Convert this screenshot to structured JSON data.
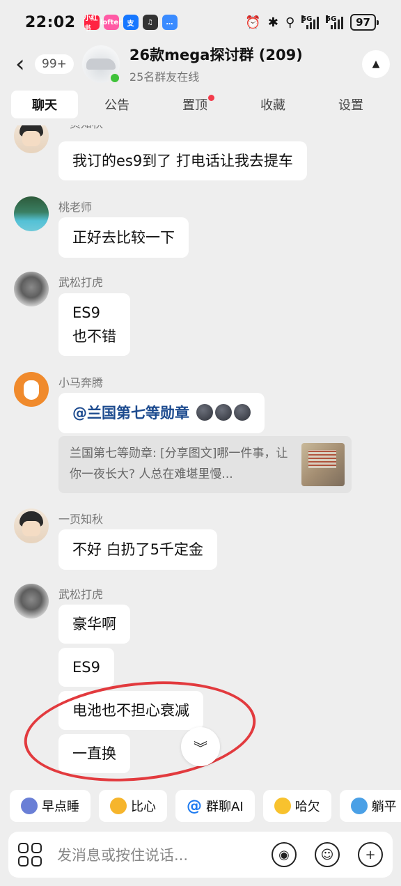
{
  "status_bar": {
    "time": "22:02",
    "apps": [
      {
        "icon": "xiaohongshu-app-icon",
        "color": "#ff2442",
        "label": "小红书"
      },
      {
        "icon": "lofter-app-icon",
        "color": "#ff5aa5",
        "label": "lofter"
      },
      {
        "icon": "alipay-app-icon",
        "color": "#1677ff",
        "label": "支"
      },
      {
        "icon": "audio-app-icon",
        "color": "#333333",
        "label": "♫"
      },
      {
        "icon": "message-app-icon",
        "color": "#3a8bff",
        "label": "…"
      }
    ],
    "signal_label_1": "5G",
    "signal_label_2": "5G",
    "battery": "97"
  },
  "header": {
    "back_badge": "99+",
    "title": "26款mega探讨群 (209)",
    "subtitle": "25名群友在线"
  },
  "tabs": [
    {
      "label": "聊天",
      "active": true
    },
    {
      "label": "公告"
    },
    {
      "label": "置顶",
      "dot": true
    },
    {
      "label": "收藏"
    },
    {
      "label": "设置"
    }
  ],
  "messages": [
    {
      "sender": "一页知秋",
      "text": "我订的es9到了 打电话让我去提车"
    },
    {
      "sender": "桃老师",
      "text": "正好去比较一下"
    },
    {
      "sender": "武松打虎",
      "lines": [
        "ES9",
        "也不错"
      ]
    },
    {
      "sender": "小马奔腾",
      "mention": "@兰国第七等勋章",
      "quote": "兰国第七等勋章: [分享图文]哪一件事，让你一夜长大? 人总在难堪里慢..."
    },
    {
      "sender": "一页知秋",
      "text": "不好 白扔了5千定金"
    },
    {
      "sender": "武松打虎",
      "texts": [
        "豪华啊",
        "ES9",
        "电池也不担心衰减",
        "一直换"
      ]
    }
  ],
  "quick_replies": [
    {
      "label": "早点睡",
      "icon": "moon-emoji-icon",
      "color": "#6a7fd6"
    },
    {
      "label": "比心",
      "icon": "heart-hand-emoji-icon",
      "color": "#f6b52c"
    },
    {
      "label": "群聊AI",
      "icon": "at-icon",
      "prefix": "@"
    },
    {
      "label": "哈欠",
      "icon": "yawn-emoji-icon",
      "color": "#f8c22e"
    },
    {
      "label": "躺平",
      "icon": "lying-flat-emoji-icon",
      "color": "#4aa0e6"
    }
  ],
  "input": {
    "placeholder": "发消息或按住说话..."
  },
  "colors": {
    "background": "#eeeeee",
    "mention": "#1d4b8f",
    "annotation": "#e23a3e",
    "online": "#3fc23a"
  }
}
